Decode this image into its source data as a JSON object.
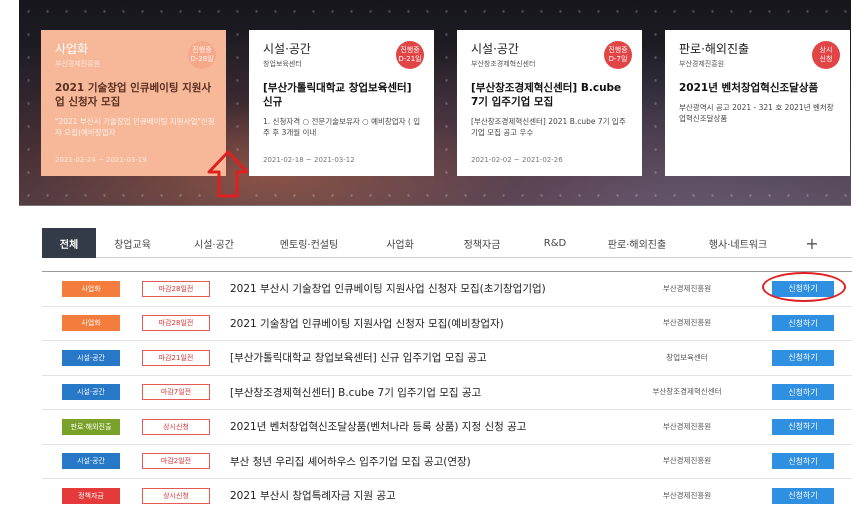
{
  "colors": {
    "accent_blue": "#2f8fe0",
    "active_tab": "#333a48",
    "badge_orange": "#f47c3c",
    "badge_blue": "#2878c8",
    "badge_green": "#7aa22a",
    "badge_red": "#e53a3a",
    "deadline_red": "#e45a5a",
    "highlight_card": "#f7b89a"
  },
  "featured": [
    {
      "category": "사업화",
      "org": "부산경제진흥원",
      "badge": [
        "진행중",
        "D-28일"
      ],
      "title": "2021 기술창업 인큐베이팅 지원사업 신청자 모집",
      "desc": "\"2021 부산시 기술창업 인큐베이팅 지원사업\"신청자 모집(예비창업자",
      "date": "2021-02-24 ~ 2021-03-19"
    },
    {
      "category": "시설·공간",
      "org": "창업보육센터",
      "badge": [
        "진행중",
        "D-21일"
      ],
      "title": "[부산가톨릭대학교 창업보육센터] 신규",
      "desc": "1. 신청자격 ○ 전문기술보유자 ○ 예비창업자 ( 입주 후 3개월 이내",
      "date": "2021-02-18 ~ 2021-03-12"
    },
    {
      "category": "시설·공간",
      "org": "부산창조경제혁신센터",
      "badge": [
        "진행중",
        "D-7일"
      ],
      "title": "[부산창조경제혁신센터] B.cube 7기 입주기업 모집",
      "desc": "[부산창조경제혁신센터] 2021 B.cube 7기 입주기업 모집 공고 우수",
      "date": "2021-02-02 ~ 2021-02-26"
    },
    {
      "category": "판로·해외진출",
      "org": "부산경제진흥원",
      "badge": [
        "상시",
        "신청"
      ],
      "title": "2021년 벤처창업혁신조달상품",
      "desc": "부산광역시 공고 2021 - 321 호 2021년 벤처창업혁신조달상품",
      "date": ""
    }
  ],
  "tabs": [
    "전체",
    "창업교육",
    "시설·공간",
    "멘토링·컨설팅",
    "사업화",
    "정책자금",
    "R&D",
    "판로·해외진출",
    "행사·네트워크",
    "+"
  ],
  "rows": [
    {
      "category": "사업화",
      "cat_color": "#f47c3c",
      "deadline": "마감28일전",
      "title": "2021 부산시 기술창업 인큐베이팅 지원사업 신청자 모집(초기창업기업)",
      "org": "부산경제진흥원",
      "button": "신청하기"
    },
    {
      "category": "사업화",
      "cat_color": "#f47c3c",
      "deadline": "마감28일전",
      "title": "2021 기술창업 인큐베이팅 지원사업 신청자 모집(예비창업자)",
      "org": "부산경제진흥원",
      "button": "신청하기"
    },
    {
      "category": "시설·공간",
      "cat_color": "#2878c8",
      "deadline": "마감21일전",
      "title": "[부산가톨릭대학교 창업보육센터] 신규 입주기업 모집 공고",
      "org": "창업보육센터",
      "button": "신청하기"
    },
    {
      "category": "시설·공간",
      "cat_color": "#2878c8",
      "deadline": "마감7일전",
      "title": "[부산창조경제혁신센터] B.cube 7기 입주기업 모집 공고",
      "org": "부산창조경제혁신센터",
      "button": "신청하기"
    },
    {
      "category": "판로·해외진출",
      "cat_color": "#7aa22a",
      "deadline": "상시신청",
      "title": "2021년 벤처창업혁신조달상품(벤처나라 등록 상품) 지정 신청 공고",
      "org": "부산경제진흥원",
      "button": "신청하기"
    },
    {
      "category": "시설·공간",
      "cat_color": "#2878c8",
      "deadline": "마감2일전",
      "title": "부산 청년 우리집 셰어하우스 입주기업 모집 공고(연장)",
      "org": "부산경제진흥원",
      "button": "신청하기"
    },
    {
      "category": "정책자금",
      "cat_color": "#e53a3a",
      "deadline": "상시신청",
      "title": "2021 부산시 창업특례자금 지원 공고",
      "org": "부산경제진흥원",
      "button": "신청하기"
    }
  ]
}
